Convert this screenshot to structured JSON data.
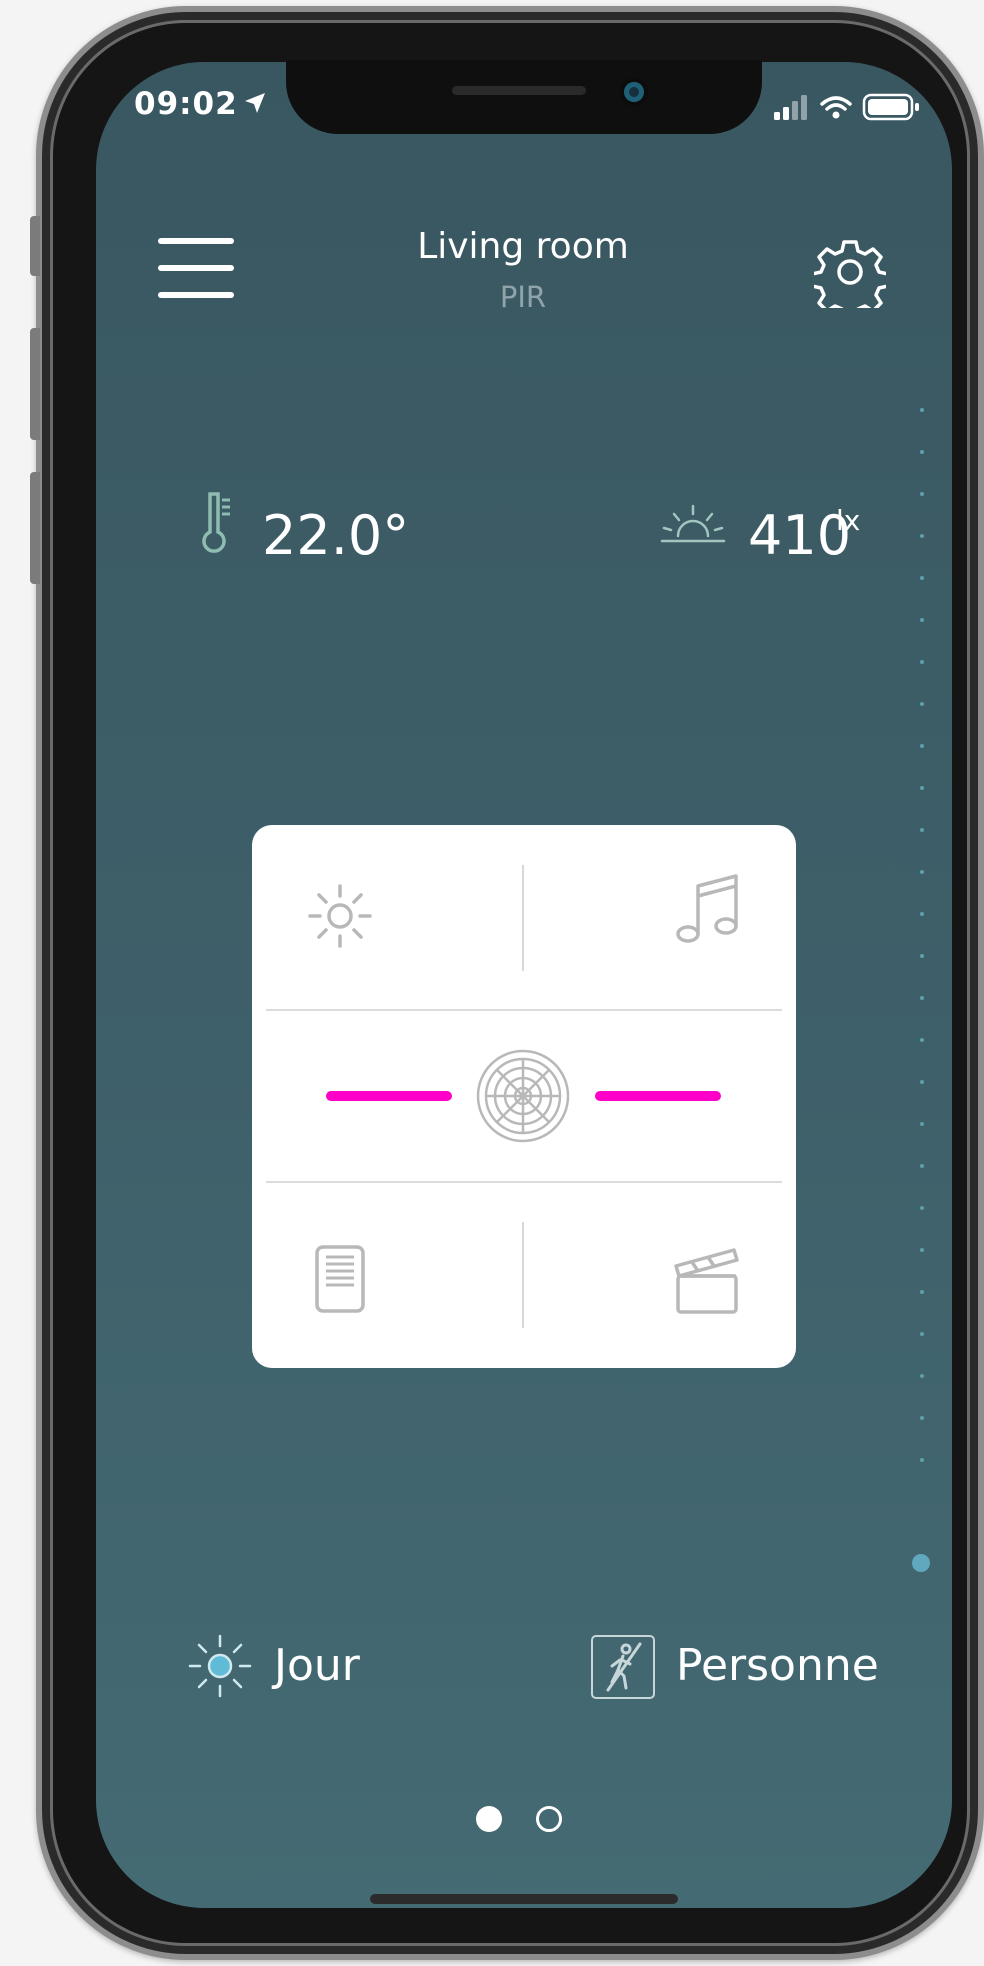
{
  "status_bar": {
    "time": "09:02",
    "location_icon": "location-arrow-icon",
    "signal_icon": "signal-icon",
    "wifi_icon": "wifi-icon",
    "battery_icon": "battery-icon"
  },
  "header": {
    "title": "Living room",
    "subtitle": "PIR",
    "menu_icon": "hamburger-menu-icon",
    "settings_icon": "gear-icon"
  },
  "readings": {
    "temperature": "22.0°",
    "light_value": "410",
    "light_unit": "lx"
  },
  "control_card": {
    "top_left_icon": "brightness-icon",
    "top_right_icon": "music-note-icon",
    "center_icon": "pir-sensor-icon",
    "bottom_left_icon": "blinds-icon",
    "bottom_right_icon": "clapperboard-icon",
    "accent_color": "#ff00c8"
  },
  "status": {
    "day_label": "Jour",
    "presence_label": "Personne"
  },
  "pagination": {
    "active_page": 1,
    "total_pages": 2
  },
  "colors": {
    "background": "#3e5f69",
    "accent_dot": "#5fa8be"
  }
}
